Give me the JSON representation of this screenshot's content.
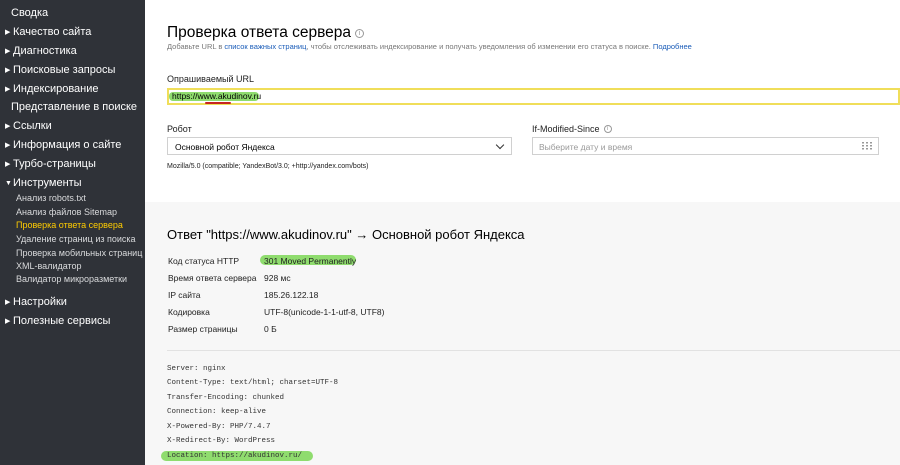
{
  "sidebar": {
    "items": [
      {
        "label": "Сводка",
        "arrow": false
      },
      {
        "label": "Качество сайта",
        "arrow": true
      },
      {
        "label": "Диагностика",
        "arrow": true
      },
      {
        "label": "Поисковые запросы",
        "arrow": true
      },
      {
        "label": "Индексирование",
        "arrow": true
      },
      {
        "label": "Представление в поиске",
        "arrow": false
      },
      {
        "label": "Ссылки",
        "arrow": true
      },
      {
        "label": "Информация о сайте",
        "arrow": true
      },
      {
        "label": "Турбо-страницы",
        "arrow": true
      },
      {
        "label": "Инструменты",
        "arrow": true,
        "expanded": true
      }
    ],
    "subitems": [
      {
        "label": "Анализ robots.txt"
      },
      {
        "label": "Анализ файлов Sitemap"
      },
      {
        "label": "Проверка ответа сервера",
        "active": true
      },
      {
        "label": "Удаление страниц из поиска"
      },
      {
        "label": "Проверка мобильных страниц"
      },
      {
        "label": "XML-валидатор"
      },
      {
        "label": "Валидатор микроразметки"
      }
    ],
    "bottom_items": [
      {
        "label": "Настройки",
        "arrow": true
      },
      {
        "label": "Полезные сервисы",
        "arrow": true
      }
    ]
  },
  "page": {
    "title": "Проверка ответа сервера",
    "info_icon": "ⓘ",
    "subtitle_before": "Добавьте URL в ",
    "subtitle_link": "список важных страниц",
    "subtitle_after": ", чтобы отслеживать индексирование и получать уведомления об изменении его статуса в поиске. ",
    "subtitle_more": "Подробнее"
  },
  "form": {
    "url_label": "Опрашиваемый URL",
    "url_value": "https://www.akudinov.ru",
    "robot_label": "Робот",
    "robot_value": "Основной робот Яндекса",
    "ims_label": "If-Modified-Since",
    "ims_placeholder": "Выберите дату и время",
    "user_agent": "Mozilla/5.0 (compatible; YandexBot/3.0; +http://yandex.com/bots)"
  },
  "response": {
    "title": "Ответ \"https://www.akudinov.ru\" → Основной робот Яндекса",
    "rows": [
      {
        "label": "Код статуса HTTP",
        "value": "301 Moved Permanently"
      },
      {
        "label": "Время ответа сервера",
        "value": "928 мс"
      },
      {
        "label": "IP сайта",
        "value": "185.26.122.18"
      },
      {
        "label": "Кодировка",
        "value": "UTF-8(unicode-1-1-utf-8, UTF8)"
      },
      {
        "label": "Размер страницы",
        "value": "0 Б"
      }
    ],
    "headers": [
      "Server: nginx",
      "Content-Type: text/html; charset=UTF-8",
      "Transfer-Encoding: chunked",
      "Connection: keep-alive",
      "X-Powered-By: PHP/7.4.7",
      "X-Redirect-By: WordPress",
      "Location: https://akudinov.ru/"
    ]
  },
  "colors": {
    "sidebar_bg": "#2f3238",
    "active_item": "#ffcc00",
    "highlight": "#8fdc6e",
    "input_border": "#f0de5a",
    "link": "#1a5cb8"
  }
}
